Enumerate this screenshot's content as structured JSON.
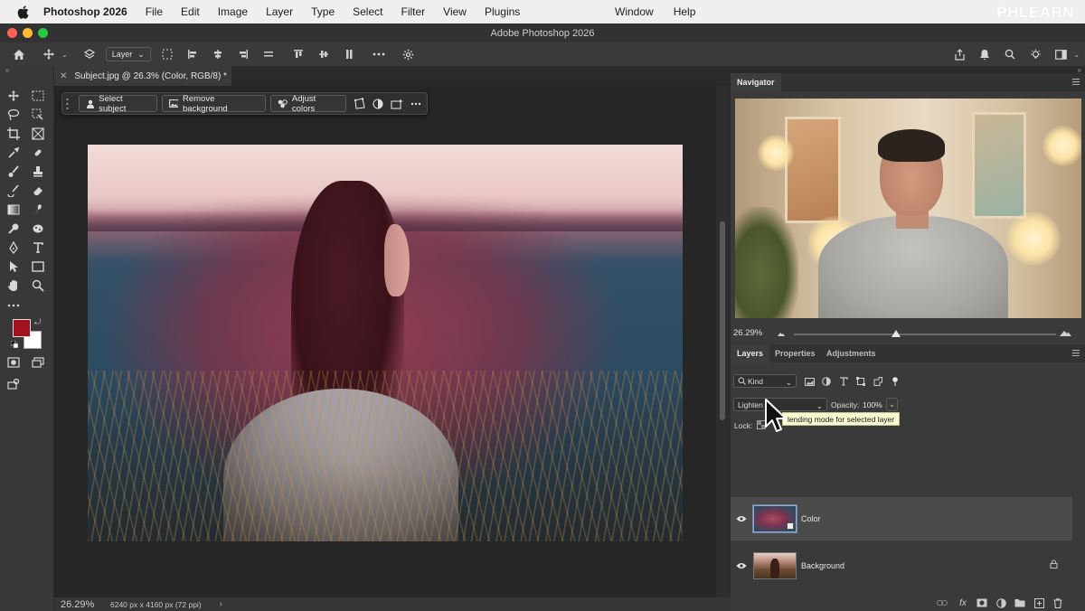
{
  "menubar": {
    "app_name": "Photoshop 2026",
    "items": [
      "File",
      "Edit",
      "Image",
      "Layer",
      "Type",
      "Select",
      "Filter",
      "View",
      "Plugins"
    ],
    "right_items": [
      "Window",
      "Help"
    ],
    "watermark": "PHLEARN"
  },
  "window": {
    "title": "Adobe Photoshop 2026"
  },
  "options_bar": {
    "sample_dropdown": "Layer"
  },
  "document": {
    "tab_title": "Subject.jpg @ 26.3% (Color, RGB/8) *"
  },
  "context_bar": {
    "select_subject": "Select subject",
    "remove_background": "Remove background",
    "adjust_colors": "Adjust colors"
  },
  "status": {
    "zoom": "26.29%",
    "dimensions": "6240 px x 4160 px (72 ppi)"
  },
  "navigator": {
    "title": "Navigator",
    "zoom": "26.29%",
    "slider_fraction": 0.39
  },
  "layers_panel": {
    "tabs": [
      "Layers",
      "Properties",
      "Adjustments"
    ],
    "filter_kind": "Kind",
    "blend_mode": "Lighten",
    "opacity_label": "Opacity:",
    "opacity_value": "100%",
    "lock_label": "Lock:",
    "tooltip": "Set the blending mode for selected layer",
    "tooltip_visible": "lending mode for selected layer",
    "layers": [
      {
        "name": "Color",
        "selected": true,
        "visible": true
      },
      {
        "name": "Background",
        "selected": false,
        "visible": true,
        "locked": true
      }
    ]
  },
  "colors": {
    "foreground": "#a3101e",
    "background": "#ffffff",
    "accent": "#6f86b5"
  }
}
